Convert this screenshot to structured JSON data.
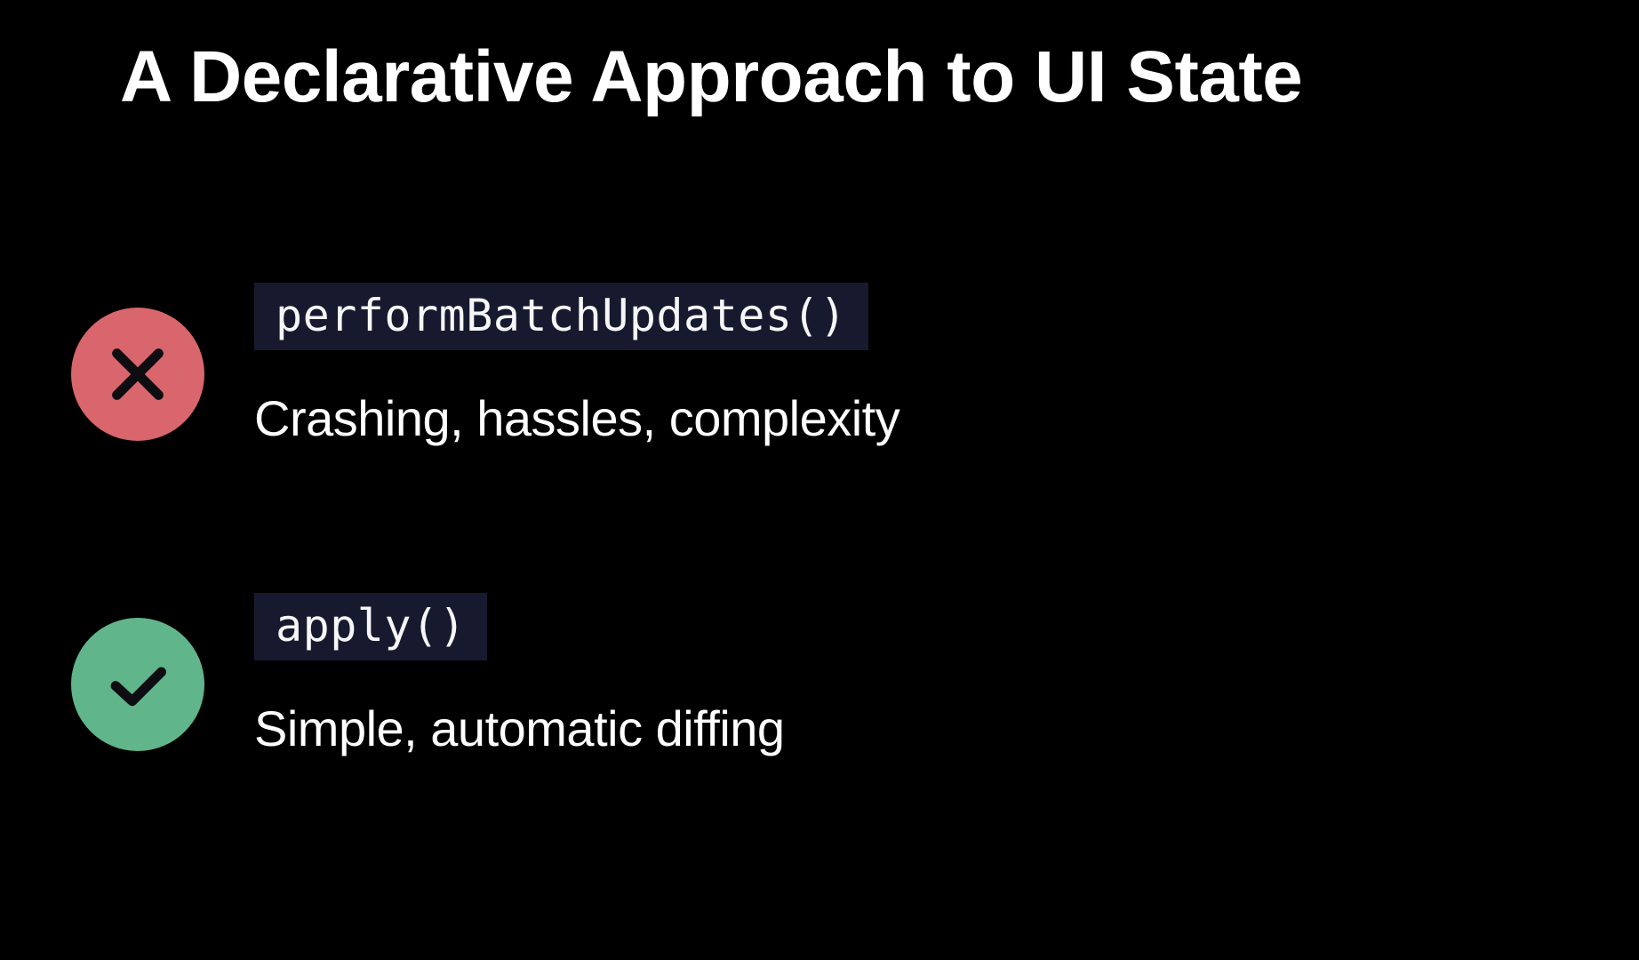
{
  "title": "A Declarative Approach to UI State",
  "items": [
    {
      "code": "performBatchUpdates()",
      "desc": "Crashing, hassles, complexity"
    },
    {
      "code": "apply()",
      "desc": "Simple, automatic diffing"
    }
  ],
  "colors": {
    "bad": "#d9666c",
    "good": "#60b58a",
    "code_bg": "#171a2f"
  }
}
